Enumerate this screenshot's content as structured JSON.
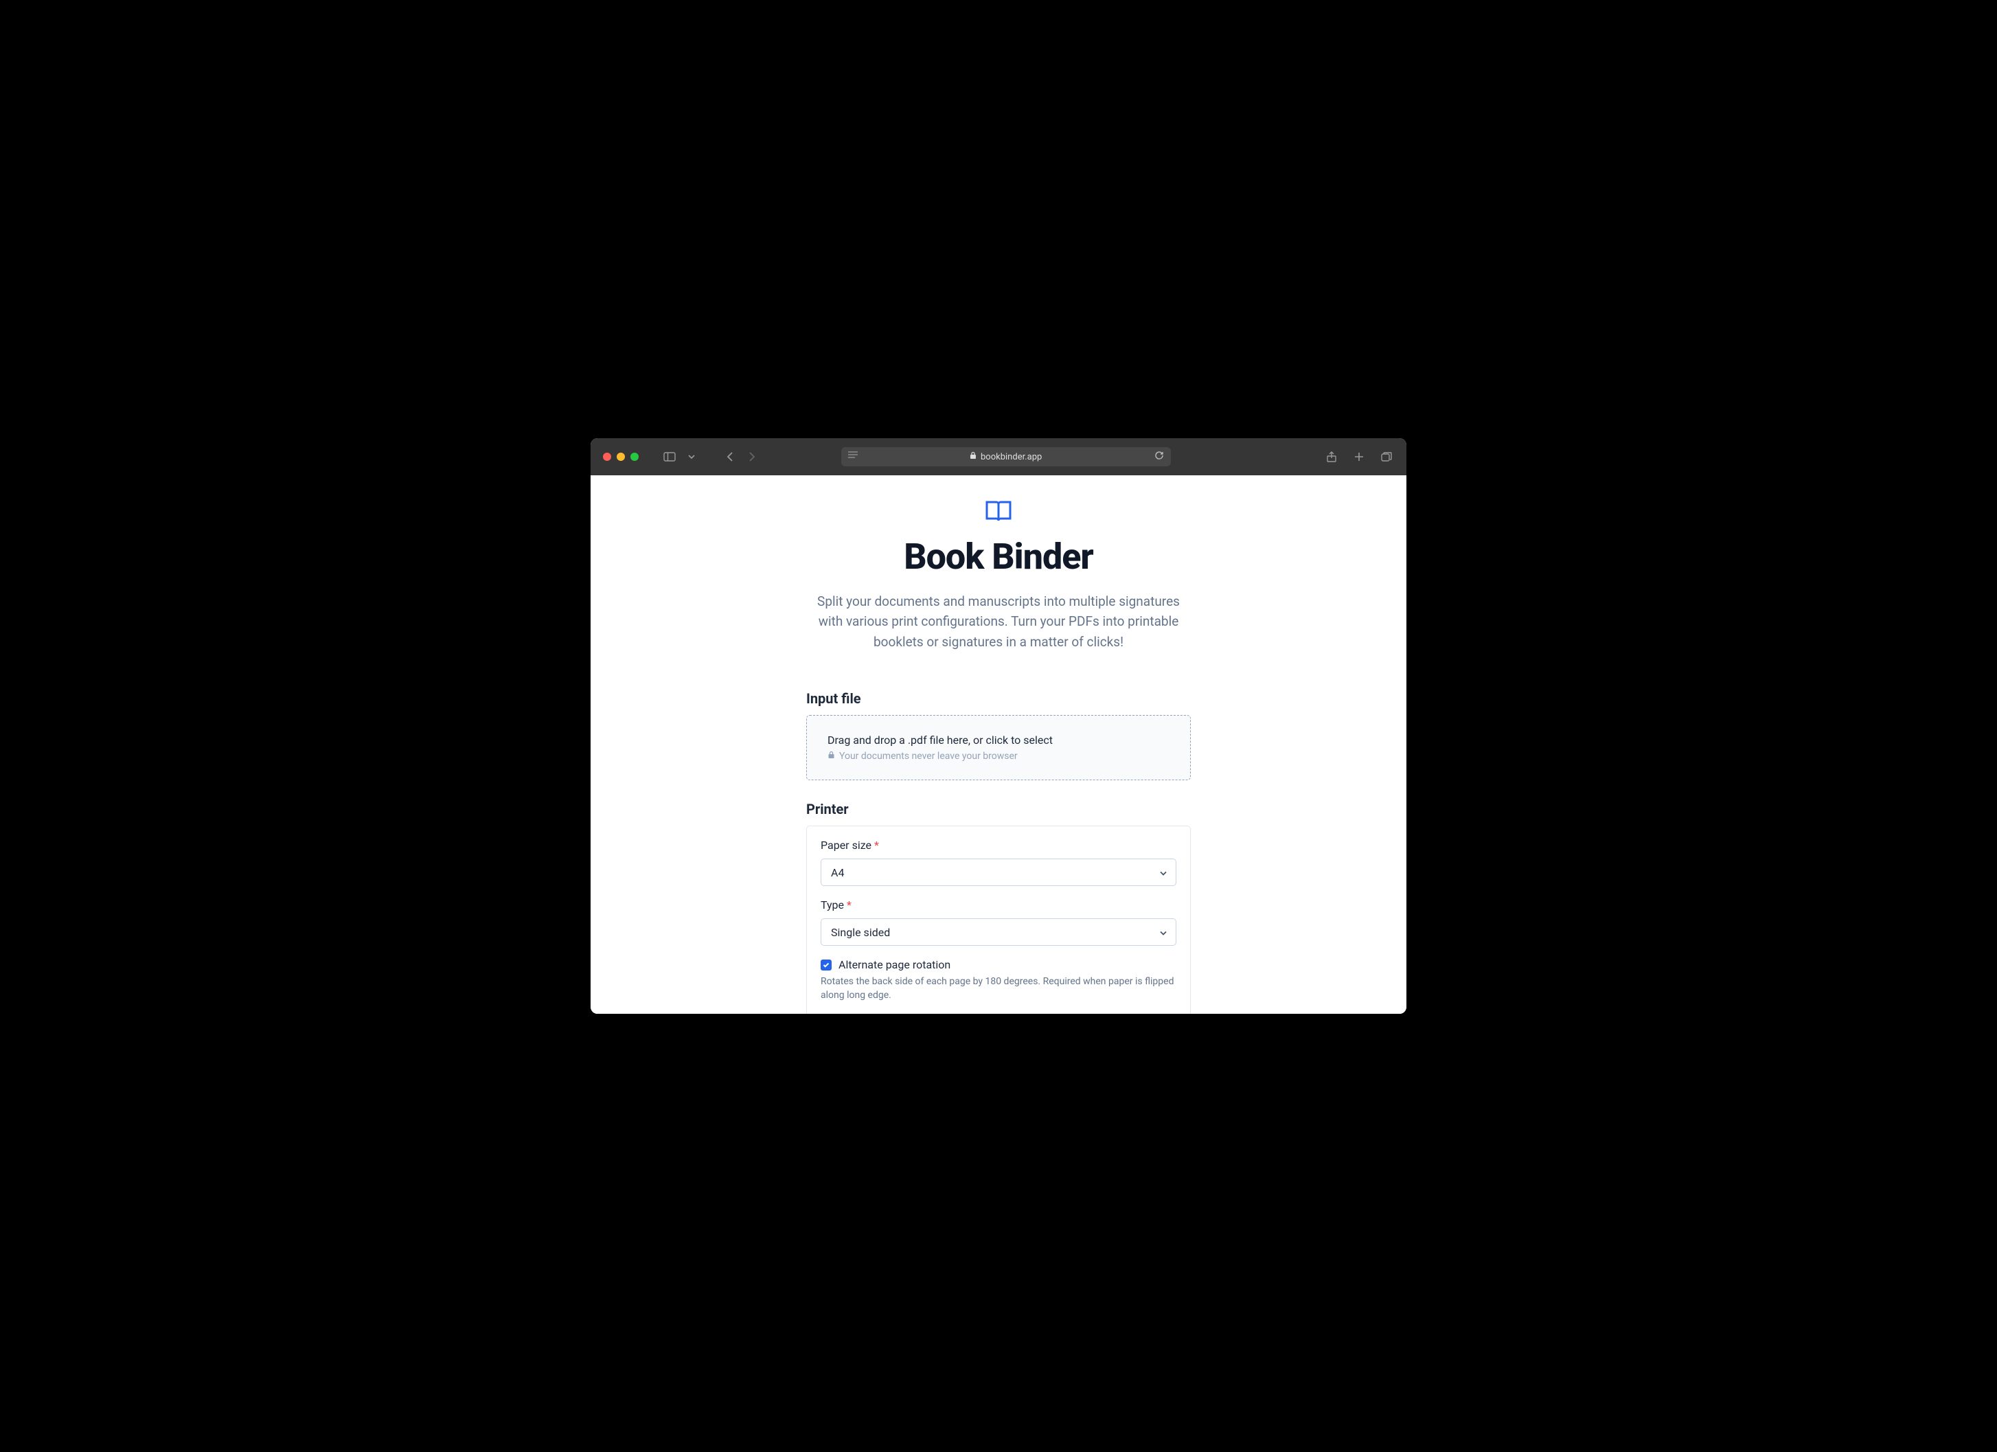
{
  "browser": {
    "url": "bookbinder.app"
  },
  "hero": {
    "title": "Book Binder",
    "description": "Split your documents and manuscripts into multiple signatures with various print configurations. Turn your PDFs into printable booklets or signatures in a matter of clicks!"
  },
  "sections": {
    "input_file": {
      "title": "Input file",
      "dropzone_main": "Drag and drop a .pdf file here, or click to select",
      "dropzone_sub": "Your documents never leave your browser"
    },
    "printer": {
      "title": "Printer",
      "paper_size": {
        "label": "Paper size",
        "value": "A4"
      },
      "type": {
        "label": "Type",
        "value": "Single sided"
      },
      "alternate_rotation": {
        "label": "Alternate page rotation",
        "checked": true,
        "help": "Rotates the back side of each page by 180 degrees. Required when paper is flipped along long edge."
      }
    }
  }
}
